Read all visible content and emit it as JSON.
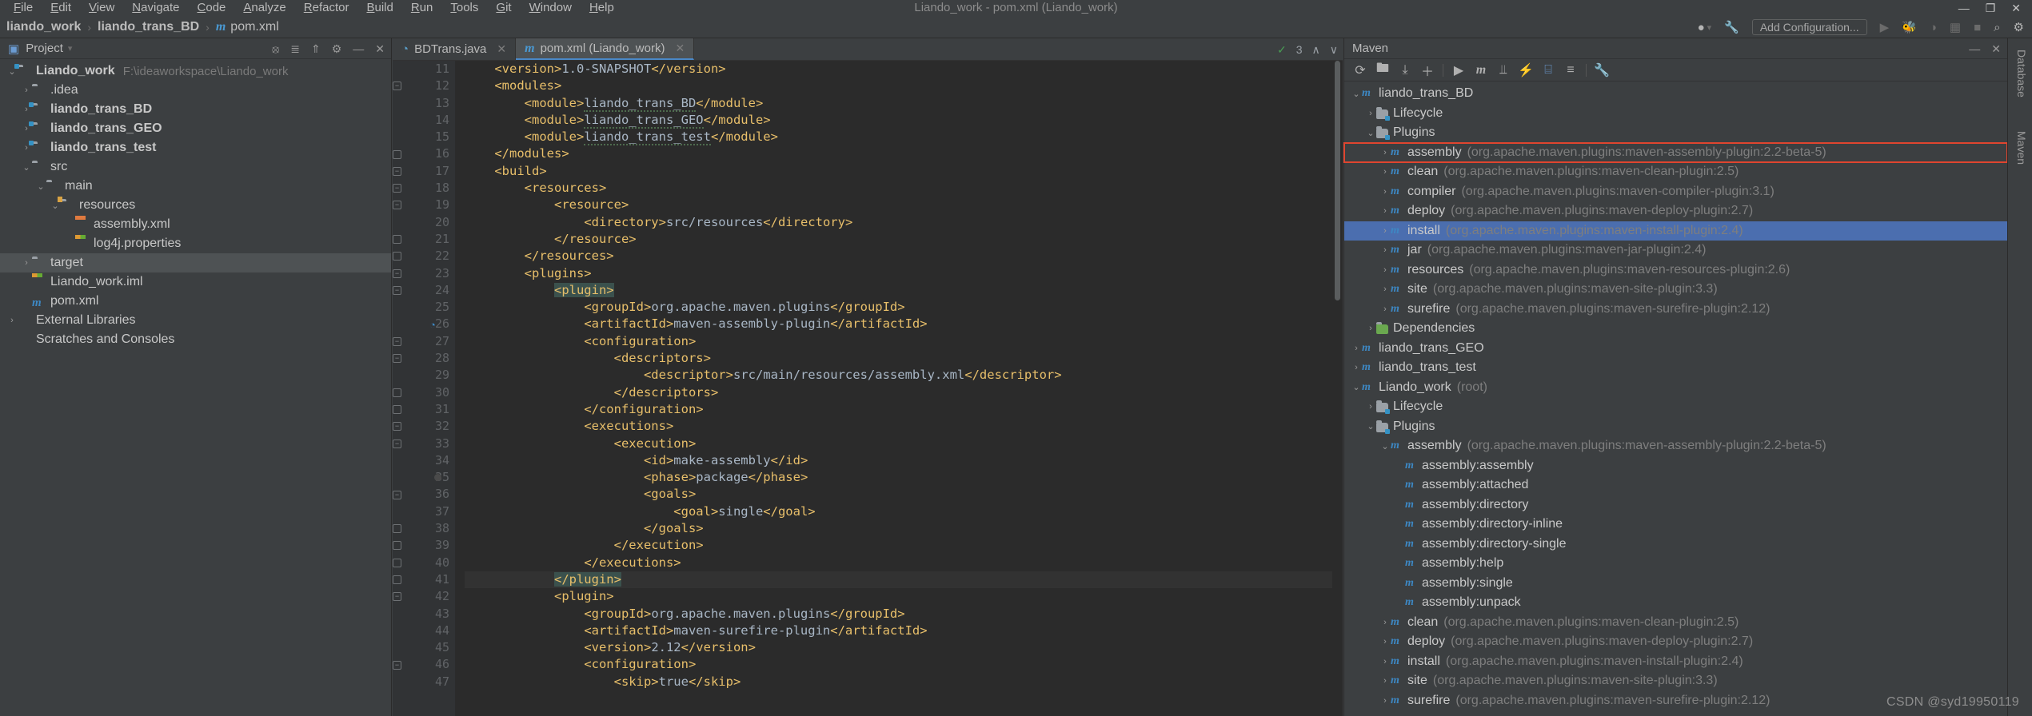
{
  "window": {
    "title": "Liando_work - pom.xml (Liando_work)",
    "minimize": "—",
    "maximize": "❐",
    "close": "✕"
  },
  "menu": {
    "items": [
      "File",
      "Edit",
      "View",
      "Navigate",
      "Code",
      "Analyze",
      "Refactor",
      "Build",
      "Run",
      "Tools",
      "Git",
      "Window",
      "Help"
    ]
  },
  "breadcrumb": {
    "items": [
      "liando_work",
      "liando_trans_BD",
      "pom.xml"
    ],
    "separator": "›",
    "maven_icon": "m"
  },
  "toolbar": {
    "account_icon": "●",
    "account_caret": "▾",
    "wrench_icon": "⚒",
    "add_configuration": "Add Configuration...",
    "run_icon": "▶",
    "debug_icon": "⚙",
    "coverage_icon": "◑",
    "profile_icon": "▦",
    "stop_icon": "■",
    "search_icon": "⌕",
    "settings_icon": "⚙"
  },
  "project_panel": {
    "title": "Project",
    "caret": "▾",
    "window_icon": "▣",
    "actions": [
      "⥁",
      "≡",
      "⇱",
      "⚙",
      "—",
      "✕"
    ],
    "tree": [
      {
        "depth": 0,
        "arrow": "v",
        "icon": "folder-module",
        "label": "Liando_work",
        "bold": true,
        "path": "F:\\ideaworkspace\\Liando_work"
      },
      {
        "depth": 1,
        "arrow": ">",
        "icon": "folder",
        "label": ".idea",
        "bold": false,
        "path": ""
      },
      {
        "depth": 1,
        "arrow": ">",
        "icon": "folder-module",
        "label": "liando_trans_BD",
        "bold": true,
        "path": ""
      },
      {
        "depth": 1,
        "arrow": ">",
        "icon": "folder-module",
        "label": "liando_trans_GEO",
        "bold": true,
        "path": ""
      },
      {
        "depth": 1,
        "arrow": ">",
        "icon": "folder-module",
        "label": "liando_trans_test",
        "bold": true,
        "path": ""
      },
      {
        "depth": 1,
        "arrow": "v",
        "icon": "folder",
        "label": "src",
        "bold": false,
        "path": ""
      },
      {
        "depth": 2,
        "arrow": "v",
        "icon": "folder",
        "label": "main",
        "bold": false,
        "path": ""
      },
      {
        "depth": 3,
        "arrow": "v",
        "icon": "folder-resources",
        "label": "resources",
        "bold": false,
        "path": ""
      },
      {
        "depth": 4,
        "arrow": "",
        "icon": "file-xml",
        "label": "assembly.xml",
        "bold": false,
        "path": ""
      },
      {
        "depth": 4,
        "arrow": "",
        "icon": "file-properties",
        "label": "log4j.properties",
        "bold": false,
        "path": ""
      },
      {
        "depth": 1,
        "arrow": ">",
        "icon": "folder",
        "label": "target",
        "bold": false,
        "path": "",
        "selected": true
      },
      {
        "depth": 1,
        "arrow": "",
        "icon": "file-iml",
        "label": "Liando_work.iml",
        "bold": false,
        "path": ""
      },
      {
        "depth": 1,
        "arrow": "",
        "icon": "maven",
        "label": "pom.xml",
        "bold": false,
        "path": ""
      },
      {
        "depth": 0,
        "arrow": ">",
        "icon": "library",
        "label": "External Libraries",
        "bold": false,
        "path": ""
      },
      {
        "depth": 0,
        "arrow": "",
        "icon": "scratch",
        "label": "Scratches and Consoles",
        "bold": false,
        "path": ""
      }
    ]
  },
  "editor": {
    "tabs": [
      {
        "label": "BDTrans.java",
        "icon": "java-class-icon",
        "active": false,
        "close": "✕"
      },
      {
        "label": "pom.xml (Liando_work)",
        "icon": "maven-icon",
        "active": true,
        "close": "✕"
      }
    ],
    "inspection_count": "3",
    "inspection_check": "✓",
    "inspection_caret_up": "∧",
    "inspection_caret_down": "∨",
    "first_line_number": 11,
    "lines": [
      {
        "n": 11,
        "indent": 4,
        "segs": [
          {
            "t": "<version>",
            "c": "tg"
          },
          {
            "t": "1.0-SNAPSHOT",
            "c": "tx"
          },
          {
            "t": "</version>",
            "c": "tg"
          }
        ]
      },
      {
        "n": 12,
        "indent": 4,
        "fold": "v",
        "segs": [
          {
            "t": "<modules>",
            "c": "tg"
          }
        ]
      },
      {
        "n": 13,
        "indent": 8,
        "segs": [
          {
            "t": "<module>",
            "c": "tg"
          },
          {
            "t": "liando_trans_BD",
            "c": "sq"
          },
          {
            "t": "</module>",
            "c": "tg"
          }
        ]
      },
      {
        "n": 14,
        "indent": 8,
        "segs": [
          {
            "t": "<module>",
            "c": "tg"
          },
          {
            "t": "liando_trans_GEO",
            "c": "sq"
          },
          {
            "t": "</module>",
            "c": "tg"
          }
        ]
      },
      {
        "n": 15,
        "indent": 8,
        "segs": [
          {
            "t": "<module>",
            "c": "tg"
          },
          {
            "t": "liando_trans_test",
            "c": "sq"
          },
          {
            "t": "</module>",
            "c": "tg"
          }
        ]
      },
      {
        "n": 16,
        "indent": 4,
        "fold": "^",
        "segs": [
          {
            "t": "</modules>",
            "c": "tg"
          }
        ]
      },
      {
        "n": 17,
        "indent": 4,
        "fold": "v",
        "segs": [
          {
            "t": "<build>",
            "c": "tg"
          }
        ]
      },
      {
        "n": 18,
        "indent": 8,
        "fold": "v",
        "segs": [
          {
            "t": "<resources>",
            "c": "tg"
          }
        ]
      },
      {
        "n": 19,
        "indent": 12,
        "fold": "v",
        "segs": [
          {
            "t": "<resource>",
            "c": "tg"
          }
        ]
      },
      {
        "n": 20,
        "indent": 16,
        "segs": [
          {
            "t": "<directory>",
            "c": "tg"
          },
          {
            "t": "src/resources",
            "c": "tx"
          },
          {
            "t": "</directory>",
            "c": "tg"
          }
        ]
      },
      {
        "n": 21,
        "indent": 12,
        "fold": "^",
        "segs": [
          {
            "t": "</resource>",
            "c": "tg"
          }
        ]
      },
      {
        "n": 22,
        "indent": 8,
        "fold": "^",
        "segs": [
          {
            "t": "</resources>",
            "c": "tg"
          }
        ]
      },
      {
        "n": 23,
        "indent": 8,
        "fold": "v",
        "segs": [
          {
            "t": "<plugins>",
            "c": "tg"
          }
        ]
      },
      {
        "n": 24,
        "indent": 12,
        "fold": "v",
        "segs": [
          {
            "t": "<plugin>",
            "c": "tg hlsel"
          }
        ]
      },
      {
        "n": 25,
        "indent": 16,
        "segs": [
          {
            "t": "<groupId>",
            "c": "tg"
          },
          {
            "t": "org.apache.maven.plugins",
            "c": "tx"
          },
          {
            "t": "</groupId>",
            "c": "tg"
          }
        ]
      },
      {
        "n": 26,
        "indent": 16,
        "gutter_icon": "run-goal-icon",
        "segs": [
          {
            "t": "<artifactId>",
            "c": "tg"
          },
          {
            "t": "maven-assembly-plugin",
            "c": "tx"
          },
          {
            "t": "</artifactId>",
            "c": "tg"
          }
        ]
      },
      {
        "n": 27,
        "indent": 16,
        "fold": "v",
        "segs": [
          {
            "t": "<configuration>",
            "c": "tg"
          }
        ]
      },
      {
        "n": 28,
        "indent": 20,
        "fold": "v",
        "segs": [
          {
            "t": "<descriptors>",
            "c": "tg"
          }
        ]
      },
      {
        "n": 29,
        "indent": 24,
        "segs": [
          {
            "t": "<descriptor>",
            "c": "tg"
          },
          {
            "t": "src/main/resources/assembly.xml",
            "c": "tx"
          },
          {
            "t": "</descriptor>",
            "c": "tg"
          }
        ]
      },
      {
        "n": 30,
        "indent": 20,
        "fold": "^",
        "segs": [
          {
            "t": "</descriptors>",
            "c": "tg"
          }
        ]
      },
      {
        "n": 31,
        "indent": 16,
        "fold": "^",
        "segs": [
          {
            "t": "</configuration>",
            "c": "tg"
          }
        ]
      },
      {
        "n": 32,
        "indent": 16,
        "fold": "v",
        "segs": [
          {
            "t": "<executions>",
            "c": "tg"
          }
        ]
      },
      {
        "n": 33,
        "indent": 20,
        "fold": "v",
        "segs": [
          {
            "t": "<execution>",
            "c": "tg"
          }
        ]
      },
      {
        "n": 34,
        "indent": 24,
        "segs": [
          {
            "t": "<id>",
            "c": "tg"
          },
          {
            "t": "make-assembly",
            "c": "tx"
          },
          {
            "t": "</id>",
            "c": "tg"
          }
        ]
      },
      {
        "n": 35,
        "indent": 24,
        "breakpoint": true,
        "segs": [
          {
            "t": "<phase>",
            "c": "tg"
          },
          {
            "t": "package",
            "c": "tx"
          },
          {
            "t": "</phase>",
            "c": "tg"
          }
        ]
      },
      {
        "n": 36,
        "indent": 24,
        "fold": "v",
        "segs": [
          {
            "t": "<goals>",
            "c": "tg"
          }
        ]
      },
      {
        "n": 37,
        "indent": 28,
        "segs": [
          {
            "t": "<goal>",
            "c": "tg"
          },
          {
            "t": "single",
            "c": "tx"
          },
          {
            "t": "</goal>",
            "c": "tg"
          }
        ]
      },
      {
        "n": 38,
        "indent": 24,
        "fold": "^",
        "segs": [
          {
            "t": "</goals>",
            "c": "tg"
          }
        ]
      },
      {
        "n": 39,
        "indent": 20,
        "fold": "^",
        "segs": [
          {
            "t": "</execution>",
            "c": "tg"
          }
        ]
      },
      {
        "n": 40,
        "indent": 16,
        "fold": "^",
        "segs": [
          {
            "t": "</executions>",
            "c": "tg"
          }
        ]
      },
      {
        "n": 41,
        "indent": 12,
        "fold": "^",
        "current": true,
        "segs": [
          {
            "t": "</plugin>",
            "c": "tg hlsel"
          }
        ]
      },
      {
        "n": 42,
        "indent": 12,
        "fold": "v",
        "segs": [
          {
            "t": "<plugin>",
            "c": "tg"
          }
        ]
      },
      {
        "n": 43,
        "indent": 16,
        "segs": [
          {
            "t": "<groupId>",
            "c": "tg"
          },
          {
            "t": "org.apache.maven.plugins",
            "c": "tx"
          },
          {
            "t": "</groupId>",
            "c": "tg"
          }
        ]
      },
      {
        "n": 44,
        "indent": 16,
        "segs": [
          {
            "t": "<artifactId>",
            "c": "tg"
          },
          {
            "t": "maven-surefire-plugin",
            "c": "tx"
          },
          {
            "t": "</artifactId>",
            "c": "tg"
          }
        ]
      },
      {
        "n": 45,
        "indent": 16,
        "segs": [
          {
            "t": "<version>",
            "c": "tg"
          },
          {
            "t": "2.12",
            "c": "tx"
          },
          {
            "t": "</version>",
            "c": "tg"
          }
        ]
      },
      {
        "n": 46,
        "indent": 16,
        "fold": "v",
        "segs": [
          {
            "t": "<configuration>",
            "c": "tg"
          }
        ]
      },
      {
        "n": 47,
        "indent": 20,
        "segs": [
          {
            "t": "<skip>",
            "c": "tg"
          },
          {
            "t": "true",
            "c": "tx"
          },
          {
            "t": "</skip>",
            "c": "tg"
          }
        ]
      }
    ]
  },
  "maven_panel": {
    "title": "Maven",
    "actions": [
      "—",
      "✕"
    ],
    "toolbar_icons": [
      {
        "name": "refresh-icon",
        "glyph": "⟳"
      },
      {
        "name": "add-maven-project-icon",
        "glyph": "Ὄ1"
      },
      {
        "name": "download-sources-icon",
        "glyph": "⤓"
      },
      {
        "name": "plus-icon",
        "glyph": "＋"
      },
      {
        "name": "run-icon",
        "glyph": "▶"
      },
      {
        "name": "execute-goal-icon",
        "glyph": "m"
      },
      {
        "name": "toggle-offline-icon",
        "glyph": "⫫"
      },
      {
        "name": "toggle-skip-tests-icon",
        "glyph": "⚡"
      },
      {
        "name": "show-dependencies-icon",
        "glyph": "⌸"
      },
      {
        "name": "collapse-all-icon",
        "glyph": "≡"
      },
      {
        "name": "maven-settings-icon",
        "glyph": "ὒ7"
      }
    ],
    "tree": [
      {
        "depth": 0,
        "arrow": "v",
        "icon": "pom",
        "label": "liando_trans_BD",
        "coord": ""
      },
      {
        "depth": 1,
        "arrow": ">",
        "icon": "lifecycle",
        "label": "Lifecycle",
        "coord": ""
      },
      {
        "depth": 1,
        "arrow": "v",
        "icon": "plugins",
        "label": "Plugins",
        "coord": ""
      },
      {
        "depth": 2,
        "arrow": ">",
        "icon": "plugin",
        "label": "assembly",
        "coord": "(org.apache.maven.plugins:maven-assembly-plugin:2.2-beta-5)",
        "boxed": true
      },
      {
        "depth": 2,
        "arrow": ">",
        "icon": "plugin",
        "label": "clean",
        "coord": "(org.apache.maven.plugins:maven-clean-plugin:2.5)"
      },
      {
        "depth": 2,
        "arrow": ">",
        "icon": "plugin",
        "label": "compiler",
        "coord": "(org.apache.maven.plugins:maven-compiler-plugin:3.1)"
      },
      {
        "depth": 2,
        "arrow": ">",
        "icon": "plugin",
        "label": "deploy",
        "coord": "(org.apache.maven.plugins:maven-deploy-plugin:2.7)"
      },
      {
        "depth": 2,
        "arrow": ">",
        "icon": "plugin",
        "label": "install",
        "coord": "(org.apache.maven.plugins:maven-install-plugin:2.4)",
        "selected": true
      },
      {
        "depth": 2,
        "arrow": ">",
        "icon": "plugin",
        "label": "jar",
        "coord": "(org.apache.maven.plugins:maven-jar-plugin:2.4)"
      },
      {
        "depth": 2,
        "arrow": ">",
        "icon": "plugin",
        "label": "resources",
        "coord": "(org.apache.maven.plugins:maven-resources-plugin:2.6)"
      },
      {
        "depth": 2,
        "arrow": ">",
        "icon": "plugin",
        "label": "site",
        "coord": "(org.apache.maven.plugins:maven-site-plugin:3.3)"
      },
      {
        "depth": 2,
        "arrow": ">",
        "icon": "plugin",
        "label": "surefire",
        "coord": "(org.apache.maven.plugins:maven-surefire-plugin:2.12)"
      },
      {
        "depth": 1,
        "arrow": ">",
        "icon": "dependencies",
        "label": "Dependencies",
        "coord": ""
      },
      {
        "depth": 0,
        "arrow": ">",
        "icon": "pom",
        "label": "liando_trans_GEO",
        "coord": ""
      },
      {
        "depth": 0,
        "arrow": ">",
        "icon": "pom",
        "label": "liando_trans_test",
        "coord": ""
      },
      {
        "depth": 0,
        "arrow": "v",
        "icon": "pom",
        "label": "Liando_work",
        "coord": "(root)"
      },
      {
        "depth": 1,
        "arrow": ">",
        "icon": "lifecycle",
        "label": "Lifecycle",
        "coord": ""
      },
      {
        "depth": 1,
        "arrow": "v",
        "icon": "plugins",
        "label": "Plugins",
        "coord": ""
      },
      {
        "depth": 2,
        "arrow": "v",
        "icon": "plugin",
        "label": "assembly",
        "coord": "(org.apache.maven.plugins:maven-assembly-plugin:2.2-beta-5)"
      },
      {
        "depth": 3,
        "arrow": "",
        "icon": "goal",
        "label": "assembly:assembly",
        "coord": ""
      },
      {
        "depth": 3,
        "arrow": "",
        "icon": "goal",
        "label": "assembly:attached",
        "coord": ""
      },
      {
        "depth": 3,
        "arrow": "",
        "icon": "goal",
        "label": "assembly:directory",
        "coord": ""
      },
      {
        "depth": 3,
        "arrow": "",
        "icon": "goal",
        "label": "assembly:directory-inline",
        "coord": ""
      },
      {
        "depth": 3,
        "arrow": "",
        "icon": "goal",
        "label": "assembly:directory-single",
        "coord": ""
      },
      {
        "depth": 3,
        "arrow": "",
        "icon": "goal",
        "label": "assembly:help",
        "coord": ""
      },
      {
        "depth": 3,
        "arrow": "",
        "icon": "goal",
        "label": "assembly:single",
        "coord": ""
      },
      {
        "depth": 3,
        "arrow": "",
        "icon": "goal",
        "label": "assembly:unpack",
        "coord": ""
      },
      {
        "depth": 2,
        "arrow": ">",
        "icon": "plugin",
        "label": "clean",
        "coord": "(org.apache.maven.plugins:maven-clean-plugin:2.5)"
      },
      {
        "depth": 2,
        "arrow": ">",
        "icon": "plugin",
        "label": "deploy",
        "coord": "(org.apache.maven.plugins:maven-deploy-plugin:2.7)"
      },
      {
        "depth": 2,
        "arrow": ">",
        "icon": "plugin",
        "label": "install",
        "coord": "(org.apache.maven.plugins:maven-install-plugin:2.4)"
      },
      {
        "depth": 2,
        "arrow": ">",
        "icon": "plugin",
        "label": "site",
        "coord": "(org.apache.maven.plugins:maven-site-plugin:3.3)"
      },
      {
        "depth": 2,
        "arrow": ">",
        "icon": "plugin",
        "label": "surefire",
        "coord": "(org.apache.maven.plugins:maven-surefire-plugin:2.12)"
      }
    ]
  },
  "right_strip": {
    "tabs": [
      "Database",
      "Maven"
    ]
  },
  "watermark": "CSDN @syd19950119",
  "colors": {
    "accent_blue": "#4b6eaf",
    "highlight_red": "#e0452f",
    "tag": "#e8bf6a",
    "text": "#a9b7c6",
    "panel_bg": "#3c3f41",
    "editor_bg": "#2b2b2b"
  }
}
